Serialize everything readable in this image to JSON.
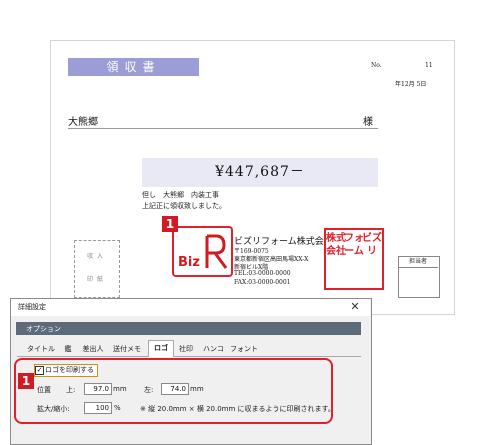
{
  "receipt": {
    "title": "領収書",
    "number_label": "No.",
    "number_value": "11",
    "date": "年12月 5日",
    "customer": "大熊郷",
    "honorific": "様",
    "amount": "¥447,687－",
    "note_line1": "但し　大熊郷　内装工事",
    "note_line2": "上記正に領収致しました。",
    "revenue_stamp_line1": "収入",
    "revenue_stamp_line2": "印紙",
    "logo_text": "Biz",
    "company_name": "ビズリフォーム株式会社",
    "postal": "〒169-0075",
    "address": "東京都新宿区高田馬場XX-X",
    "building": "新宿ビルX階",
    "tel": "TEL:03-0000-0000",
    "fax": "FAX:03-0000-0001",
    "hanko_col1": "ビズリ",
    "hanko_col2": "フォーム",
    "hanko_col3": "株式会社",
    "manager_label": "担当者"
  },
  "badges": {
    "badge1": "1",
    "badge2": "1"
  },
  "dialog": {
    "title": "詳細設定",
    "close": "✕",
    "options_label": "オプション",
    "tabs": [
      {
        "label": "タイトル",
        "active": false
      },
      {
        "label": "鑑",
        "active": false
      },
      {
        "label": "差出人",
        "active": false
      },
      {
        "label": "送付メモ",
        "active": false
      },
      {
        "label": "ロゴ",
        "active": true
      },
      {
        "label": "社印",
        "active": false
      },
      {
        "label": "ハンコ",
        "active": false
      },
      {
        "label": "フォント",
        "active": false
      }
    ],
    "print_logo_label": "ロゴを印刷する",
    "print_logo_checked": true,
    "position_label": "位置",
    "top_label": "上:",
    "top_value": "97.0",
    "top_unit": "mm",
    "left_label": "左:",
    "left_value": "74.0",
    "left_unit": "mm",
    "scale_label": "拡大/縮小:",
    "scale_value": "100",
    "scale_unit": "%",
    "scale_note": "※ 縦 20.0mm × 横 20.0mm に収まるように印刷されます。"
  },
  "colors": {
    "accent_red": "#e0202a",
    "title_purple": "#9c9cd6",
    "option_bar": "#5c6a79"
  }
}
